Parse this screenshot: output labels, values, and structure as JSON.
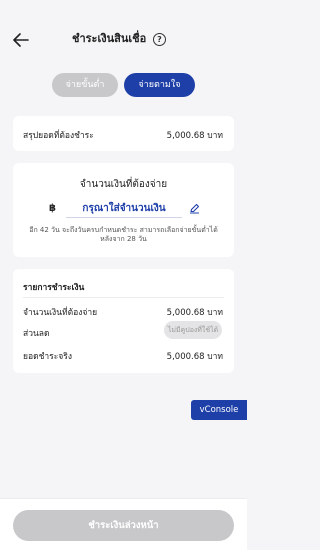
{
  "header": {
    "title": "ชำระเงินสินเชื่อ",
    "back_icon": "arrow-left-icon",
    "help_icon": "question-circle-icon",
    "help_glyph": "?"
  },
  "segments": {
    "minimum_label": "จ่ายขั้นต่ำ",
    "custom_label": "จ่ายตามใจ",
    "selected": "custom"
  },
  "summary": {
    "label": "สรุปยอดที่ต้องชำระ",
    "value": "5,000.68 บาท"
  },
  "amount_card": {
    "title": "จำนวนเงินที่ต้องจ่าย",
    "currency_symbol": "฿",
    "input_placeholder": "กรุณาใส่จำนวนเงิน",
    "input_value": "",
    "edit_icon": "pencil-icon",
    "hint": "อีก 42 วัน จะถึงวันครบกำหนดชำระ สามารถเลือกจ่ายขั้นต่ำได้หลังจาก 28 วัน"
  },
  "details": {
    "title": "รายการชำระเงิน",
    "rows": [
      {
        "label": "จำนวนเงินที่ต้องจ่าย",
        "value": "5,000.68 บาท"
      },
      {
        "label": "ส่วนลด",
        "value": "ไม่มีคูปองที่ใช้ได้"
      },
      {
        "label": "ยอดชำระจริง",
        "value": "5,000.68 บาท"
      }
    ]
  },
  "vconsole_label": "vConsole",
  "footer": {
    "submit_label": "ชำระเงินล่วงหน้า"
  },
  "colors": {
    "accent": "#1e3fa8",
    "disabled": "#c8c8ca",
    "background": "#f5f5f7"
  }
}
